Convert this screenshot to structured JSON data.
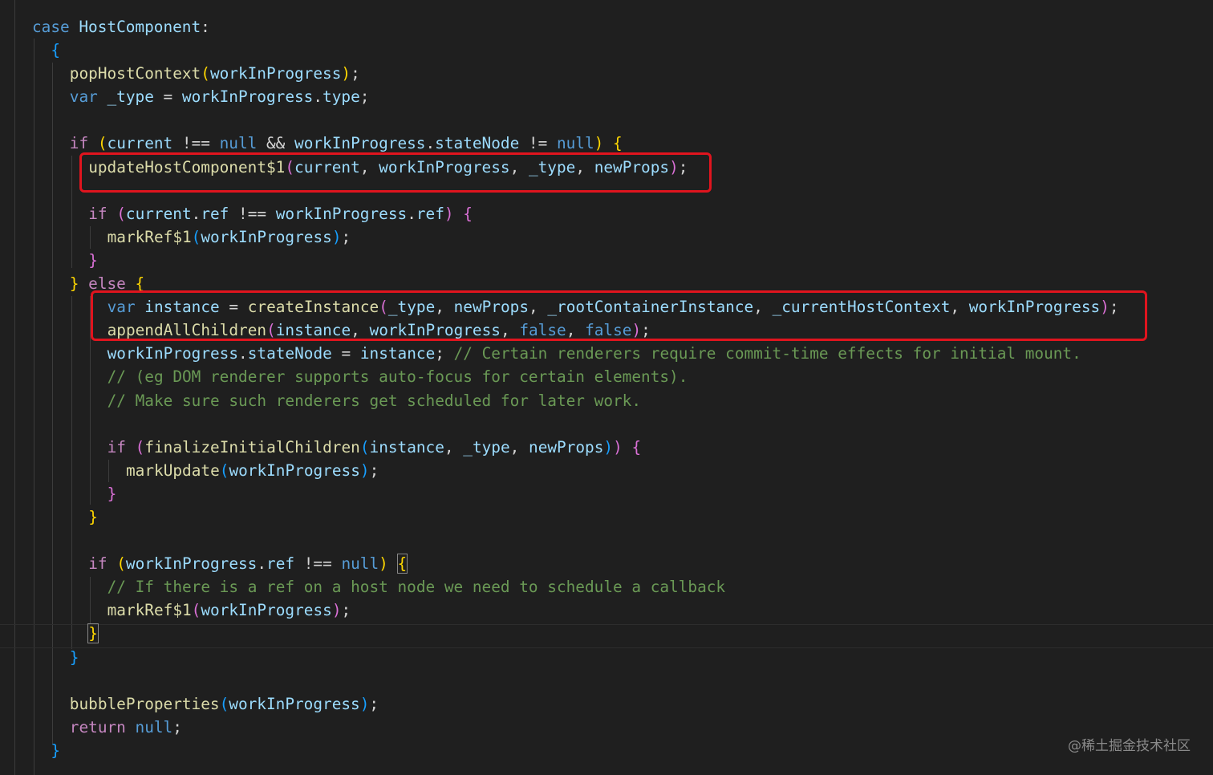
{
  "lines": [
    {
      "indent": 0,
      "tokens": [
        {
          "t": "case ",
          "c": "kw"
        },
        {
          "t": "HostComponent",
          "c": "var"
        },
        {
          "t": ":",
          "c": "p"
        }
      ]
    },
    {
      "indent": 1,
      "tokens": [
        {
          "t": "{",
          "c": "b3"
        }
      ]
    },
    {
      "indent": 2,
      "tokens": [
        {
          "t": "popHostContext",
          "c": "fn"
        },
        {
          "t": "(",
          "c": "b1"
        },
        {
          "t": "workInProgress",
          "c": "var"
        },
        {
          "t": ")",
          "c": "b1"
        },
        {
          "t": ";",
          "c": "p"
        }
      ]
    },
    {
      "indent": 2,
      "tokens": [
        {
          "t": "var ",
          "c": "kw"
        },
        {
          "t": "_type",
          "c": "var"
        },
        {
          "t": " = ",
          "c": "p"
        },
        {
          "t": "workInProgress",
          "c": "var"
        },
        {
          "t": ".",
          "c": "p"
        },
        {
          "t": "type",
          "c": "var"
        },
        {
          "t": ";",
          "c": "p"
        }
      ]
    },
    {
      "indent": 0,
      "tokens": []
    },
    {
      "indent": 2,
      "tokens": [
        {
          "t": "if ",
          "c": "ctrl"
        },
        {
          "t": "(",
          "c": "b1"
        },
        {
          "t": "current",
          "c": "var"
        },
        {
          "t": " !== ",
          "c": "p"
        },
        {
          "t": "null",
          "c": "kw"
        },
        {
          "t": " && ",
          "c": "p"
        },
        {
          "t": "workInProgress",
          "c": "var"
        },
        {
          "t": ".",
          "c": "p"
        },
        {
          "t": "stateNode",
          "c": "var"
        },
        {
          "t": " != ",
          "c": "p"
        },
        {
          "t": "null",
          "c": "kw"
        },
        {
          "t": ") ",
          "c": "b1"
        },
        {
          "t": "{",
          "c": "b1"
        }
      ]
    },
    {
      "indent": 3,
      "tokens": [
        {
          "t": "updateHostComponent$1",
          "c": "fn"
        },
        {
          "t": "(",
          "c": "b2"
        },
        {
          "t": "current",
          "c": "var"
        },
        {
          "t": ", ",
          "c": "p"
        },
        {
          "t": "workInProgress",
          "c": "var"
        },
        {
          "t": ", ",
          "c": "p"
        },
        {
          "t": "_type",
          "c": "var"
        },
        {
          "t": ", ",
          "c": "p"
        },
        {
          "t": "newProps",
          "c": "var"
        },
        {
          "t": ")",
          "c": "b2"
        },
        {
          "t": ";",
          "c": "p"
        }
      ]
    },
    {
      "indent": 0,
      "tokens": []
    },
    {
      "indent": 3,
      "tokens": [
        {
          "t": "if ",
          "c": "ctrl"
        },
        {
          "t": "(",
          "c": "b2"
        },
        {
          "t": "current",
          "c": "var"
        },
        {
          "t": ".",
          "c": "p"
        },
        {
          "t": "ref",
          "c": "var"
        },
        {
          "t": " !== ",
          "c": "p"
        },
        {
          "t": "workInProgress",
          "c": "var"
        },
        {
          "t": ".",
          "c": "p"
        },
        {
          "t": "ref",
          "c": "var"
        },
        {
          "t": ") ",
          "c": "b2"
        },
        {
          "t": "{",
          "c": "b2"
        }
      ]
    },
    {
      "indent": 4,
      "tokens": [
        {
          "t": "markRef$1",
          "c": "fn"
        },
        {
          "t": "(",
          "c": "b3"
        },
        {
          "t": "workInProgress",
          "c": "var"
        },
        {
          "t": ")",
          "c": "b3"
        },
        {
          "t": ";",
          "c": "p"
        }
      ]
    },
    {
      "indent": 3,
      "tokens": [
        {
          "t": "}",
          "c": "b2"
        }
      ]
    },
    {
      "indent": 2,
      "tokens": [
        {
          "t": "} ",
          "c": "b1"
        },
        {
          "t": "else ",
          "c": "ctrl"
        },
        {
          "t": "{",
          "c": "b1"
        }
      ]
    },
    {
      "indent": 4,
      "tokens": [
        {
          "t": "var ",
          "c": "kw"
        },
        {
          "t": "instance",
          "c": "var"
        },
        {
          "t": " = ",
          "c": "p"
        },
        {
          "t": "createInstance",
          "c": "fn"
        },
        {
          "t": "(",
          "c": "b2"
        },
        {
          "t": "_type",
          "c": "var"
        },
        {
          "t": ", ",
          "c": "p"
        },
        {
          "t": "newProps",
          "c": "var"
        },
        {
          "t": ", ",
          "c": "p"
        },
        {
          "t": "_rootContainerInstance",
          "c": "var"
        },
        {
          "t": ", ",
          "c": "p"
        },
        {
          "t": "_currentHostContext",
          "c": "var"
        },
        {
          "t": ", ",
          "c": "p"
        },
        {
          "t": "workInProgress",
          "c": "var"
        },
        {
          "t": ")",
          "c": "b2"
        },
        {
          "t": ";",
          "c": "p"
        }
      ]
    },
    {
      "indent": 4,
      "tokens": [
        {
          "t": "appendAllChildren",
          "c": "fn"
        },
        {
          "t": "(",
          "c": "b2"
        },
        {
          "t": "instance",
          "c": "var"
        },
        {
          "t": ", ",
          "c": "p"
        },
        {
          "t": "workInProgress",
          "c": "var"
        },
        {
          "t": ", ",
          "c": "p"
        },
        {
          "t": "false",
          "c": "kw"
        },
        {
          "t": ", ",
          "c": "p"
        },
        {
          "t": "false",
          "c": "kw"
        },
        {
          "t": ")",
          "c": "b2"
        },
        {
          "t": ";",
          "c": "p"
        }
      ]
    },
    {
      "indent": 4,
      "tokens": [
        {
          "t": "workInProgress",
          "c": "var"
        },
        {
          "t": ".",
          "c": "p"
        },
        {
          "t": "stateNode",
          "c": "var"
        },
        {
          "t": " = ",
          "c": "p"
        },
        {
          "t": "instance",
          "c": "var"
        },
        {
          "t": "; ",
          "c": "p"
        },
        {
          "t": "// Certain renderers require commit-time effects for initial mount.",
          "c": "cm"
        }
      ]
    },
    {
      "indent": 4,
      "tokens": [
        {
          "t": "// (eg DOM renderer supports auto-focus for certain elements).",
          "c": "cm"
        }
      ]
    },
    {
      "indent": 4,
      "tokens": [
        {
          "t": "// Make sure such renderers get scheduled for later work.",
          "c": "cm"
        }
      ]
    },
    {
      "indent": 0,
      "tokens": []
    },
    {
      "indent": 4,
      "tokens": [
        {
          "t": "if ",
          "c": "ctrl"
        },
        {
          "t": "(",
          "c": "b2"
        },
        {
          "t": "finalizeInitialChildren",
          "c": "fn"
        },
        {
          "t": "(",
          "c": "b3"
        },
        {
          "t": "instance",
          "c": "var"
        },
        {
          "t": ", ",
          "c": "p"
        },
        {
          "t": "_type",
          "c": "var"
        },
        {
          "t": ", ",
          "c": "p"
        },
        {
          "t": "newProps",
          "c": "var"
        },
        {
          "t": ")",
          "c": "b3"
        },
        {
          "t": ") ",
          "c": "b2"
        },
        {
          "t": "{",
          "c": "b2"
        }
      ]
    },
    {
      "indent": 5,
      "tokens": [
        {
          "t": "markUpdate",
          "c": "fn"
        },
        {
          "t": "(",
          "c": "b3"
        },
        {
          "t": "workInProgress",
          "c": "var"
        },
        {
          "t": ")",
          "c": "b3"
        },
        {
          "t": ";",
          "c": "p"
        }
      ]
    },
    {
      "indent": 4,
      "tokens": [
        {
          "t": "}",
          "c": "b2"
        }
      ]
    },
    {
      "indent": 3,
      "tokens": [
        {
          "t": "}",
          "c": "b1"
        }
      ]
    },
    {
      "indent": 0,
      "tokens": []
    },
    {
      "indent": 3,
      "tokens": [
        {
          "t": "if ",
          "c": "ctrl"
        },
        {
          "t": "(",
          "c": "b1"
        },
        {
          "t": "workInProgress",
          "c": "var"
        },
        {
          "t": ".",
          "c": "p"
        },
        {
          "t": "ref",
          "c": "var"
        },
        {
          "t": " !== ",
          "c": "p"
        },
        {
          "t": "null",
          "c": "kw"
        },
        {
          "t": ") ",
          "c": "b1"
        },
        {
          "t": "{",
          "c": "b1m"
        }
      ]
    },
    {
      "indent": 4,
      "tokens": [
        {
          "t": "// If there is a ref on a host node we need to schedule a callback",
          "c": "cm"
        }
      ]
    },
    {
      "indent": 4,
      "tokens": [
        {
          "t": "markRef$1",
          "c": "fn"
        },
        {
          "t": "(",
          "c": "b2"
        },
        {
          "t": "workInProgress",
          "c": "var"
        },
        {
          "t": ")",
          "c": "b2"
        },
        {
          "t": ";",
          "c": "p"
        }
      ]
    },
    {
      "indent": 3,
      "tokens": [
        {
          "t": "}",
          "c": "b1m"
        }
      ]
    },
    {
      "indent": 2,
      "tokens": [
        {
          "t": "}",
          "c": "b3"
        }
      ]
    },
    {
      "indent": 0,
      "tokens": []
    },
    {
      "indent": 2,
      "tokens": [
        {
          "t": "bubbleProperties",
          "c": "fn"
        },
        {
          "t": "(",
          "c": "b3"
        },
        {
          "t": "workInProgress",
          "c": "var"
        },
        {
          "t": ")",
          "c": "b3"
        },
        {
          "t": ";",
          "c": "p"
        }
      ]
    },
    {
      "indent": 2,
      "tokens": [
        {
          "t": "return ",
          "c": "ctrl"
        },
        {
          "t": "null",
          "c": "kw"
        },
        {
          "t": ";",
          "c": "p"
        }
      ]
    },
    {
      "indent": 1,
      "tokens": [
        {
          "t": "}",
          "c": "b3"
        }
      ]
    }
  ],
  "watermark": "@稀土掘金技术社区"
}
